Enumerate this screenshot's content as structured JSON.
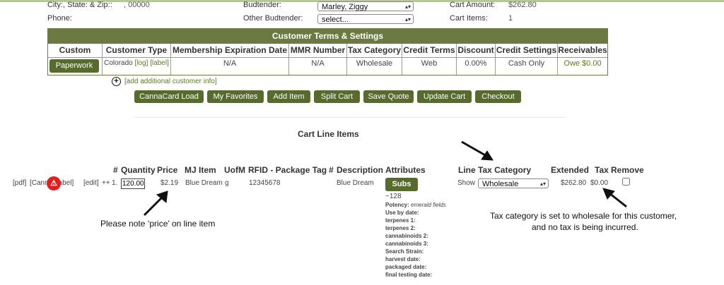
{
  "top": {
    "city_label": "City:, State: & Zip::",
    "city_value": ", 00000",
    "phone_label": "Phone:",
    "budtender_label": "Budtender:",
    "budtender_value": "Marley, Ziggy",
    "other_budtender_label": "Other Budtender:",
    "other_budtender_value": "select...",
    "cart_amount_label": "Cart Amount:",
    "cart_amount_value": "$262.80",
    "cart_items_label": "Cart Items:",
    "cart_items_value": "1"
  },
  "terms": {
    "title": "Customer Terms & Settings",
    "headers": [
      "Custom",
      "Customer Type",
      "Membership Expiration Date",
      "MMR Number",
      "Tax Category",
      "Credit Terms",
      "Discount",
      "Credit Settings",
      "Receivables"
    ],
    "paperwork_label": "Paperwork",
    "customer_type": "Colorado",
    "log_link": "[log]",
    "label_link": "[label]",
    "membership_exp": "N/A",
    "mmr_number": "N/A",
    "tax_category": "Wholesale",
    "credit_terms": "Web",
    "discount": "0.00%",
    "credit_settings": "Cash Only",
    "receivables": "Owe $0.00",
    "add_info_link": "[add additional customer info]"
  },
  "actions": {
    "cannacard": "CannaCard Load",
    "favorites": "My Favorites",
    "add_item": "Add Item",
    "split_cart": "Split Cart",
    "save_quote": "Save Quote",
    "update_cart": "Update Cart",
    "checkout": "Checkout"
  },
  "cart": {
    "title": "Cart Line Items",
    "headers": {
      "num": "#",
      "quantity": "Quantity",
      "price": "Price",
      "mj_item": "MJ Item",
      "uofm": "UofM",
      "rfid": "RFID - Package Tag",
      "description_num": "#",
      "description": "Description",
      "attributes": "Attributes",
      "line": "Line",
      "tax_category": "Tax Category",
      "extended": "Extended",
      "tax": "Tax",
      "remove": "Remove"
    },
    "row": {
      "pdf_link": "[pdf]",
      "canna_label_link": "[Canna Label]",
      "edit_link": "[edit]",
      "plusplus": "++",
      "line_num": "1.",
      "quantity": "120.00",
      "price": "$2.19",
      "mj_item": "Blue Dream",
      "uofm": "g",
      "rfid": "12345678",
      "description": "Blue Dream",
      "subs_label": "Subs",
      "approx": "~128",
      "potency_label": "Potency:",
      "potency_value": "emerald fields",
      "attr_lines": [
        "Use by date:",
        "terpenes 1:",
        "terpenes 2:",
        "cannabinoids 2:",
        "cannabinoids 3:",
        "Search Strain:",
        "harvest date:",
        "packaged date:",
        "final testing date:"
      ],
      "show_label": "Show",
      "tax_category": "Wholesale",
      "extended": "$262.80",
      "tax": "$0.00"
    }
  },
  "annotations": {
    "price_note": "Please note ‘price’ on line item",
    "tax_note_line1": "Tax category is set to wholesale for this customer,",
    "tax_note_line2": "and no tax is being incurred."
  },
  "colors": {
    "accent": "#566b2d",
    "header_bar": "#6a7a41",
    "link": "#5a7a1e",
    "warning": "#e02020"
  }
}
